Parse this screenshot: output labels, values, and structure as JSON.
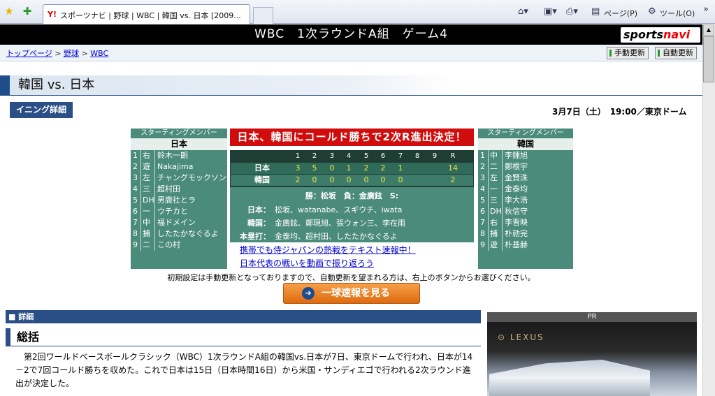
{
  "browser": {
    "tab_title": "スポーツナビ | 野球 | WBC | 韓国 vs. 日本 [2009...",
    "toolbar": {
      "page_menu": "ページ(P)",
      "tools_menu": "ツール(O)"
    },
    "icons": [
      "favorites-star-icon",
      "add-favorites-icon",
      "home-icon",
      "feeds-icon",
      "print-icon",
      "page-icon",
      "tools-gear-icon"
    ]
  },
  "site": {
    "header_title": "WBC　1次ラウンドA組　ゲーム4",
    "logo_sports": "sports",
    "logo_navi": "navi"
  },
  "breadcrumb": [
    {
      "label": "トップページ"
    },
    {
      "label": "野球"
    },
    {
      "label": "WBC"
    }
  ],
  "update_buttons": {
    "manual": "手動更新",
    "auto": "自動更新"
  },
  "page": {
    "title": "韓国 vs. 日本",
    "inning_button": "イニング詳細",
    "date": "3月7日（土）　19:00／東京ドーム"
  },
  "lineup_japan": {
    "caption": "スターティングメンバー",
    "team": "日本",
    "players": [
      {
        "no": "1",
        "pos": "右",
        "name": "鈴木一朗"
      },
      {
        "no": "2",
        "pos": "遊",
        "name": "Nakajima"
      },
      {
        "no": "3",
        "pos": "左",
        "name": "チャングモックソンチン"
      },
      {
        "no": "4",
        "pos": "三",
        "name": "超村田"
      },
      {
        "no": "5",
        "pos": "DH",
        "name": "男鹿社とラ"
      },
      {
        "no": "6",
        "pos": "一",
        "name": "ウチカと"
      },
      {
        "no": "7",
        "pos": "中",
        "name": "福ドメイン"
      },
      {
        "no": "8",
        "pos": "捕",
        "name": "したたかなぐるよ"
      },
      {
        "no": "9",
        "pos": "二",
        "name": "この村"
      }
    ]
  },
  "lineup_korea": {
    "caption": "スターティングメンバー",
    "team": "韓国",
    "players": [
      {
        "no": "1",
        "pos": "中",
        "name": "李鍾旭"
      },
      {
        "no": "2",
        "pos": "二",
        "name": "鄭根宇"
      },
      {
        "no": "3",
        "pos": "左",
        "name": "金賢洙"
      },
      {
        "no": "4",
        "pos": "一",
        "name": "金泰均"
      },
      {
        "no": "5",
        "pos": "三",
        "name": "李大浩"
      },
      {
        "no": "6",
        "pos": "DH",
        "name": "秋信守"
      },
      {
        "no": "7",
        "pos": "右",
        "name": "李晋映"
      },
      {
        "no": "8",
        "pos": "捕",
        "name": "朴勍完"
      },
      {
        "no": "9",
        "pos": "遊",
        "name": "朴基赫"
      }
    ]
  },
  "headline": "日本、韓国にコールド勝ちで2次R進出決定！",
  "scoreboard": {
    "innings": [
      "1",
      "2",
      "3",
      "4",
      "5",
      "6",
      "7",
      "8",
      "9",
      "R"
    ],
    "teams": [
      {
        "name": "日本",
        "scores": [
          "3",
          "5",
          "0",
          "1",
          "2",
          "2",
          "1",
          "",
          "",
          "14"
        ]
      },
      {
        "name": "韓国",
        "scores": [
          "2",
          "0",
          "0",
          "0",
          "0",
          "0",
          "0",
          "",
          "",
          "2"
        ]
      }
    ]
  },
  "results": {
    "decision": "勝：松坂　負：金廣鉉　S:",
    "pitchers_rows": [
      {
        "label": "日本：",
        "value": "松坂、watanabe、スギウチ、iwata"
      },
      {
        "label": "韓国：",
        "value": "金廣鉉、鄭現旭、張ウォン三、李在雨"
      },
      {
        "label": "本塁打：",
        "value": "金泰均、超村田、したたかなぐるよ"
      }
    ]
  },
  "links": {
    "mobile": "携帯でも侍ジャパンの熱戦をテキスト速報中！",
    "video": "日本代表の戦いを動画で振り返ろう"
  },
  "notice": "初期設定は手動更新となっておりますので、自動更新を望まれる方は、右上のボタンからお選びください。",
  "ikkyu_button": "一球速報を見る",
  "detail": {
    "header": "詳細",
    "summary_title": "総括",
    "summary_text": "第2回ワールドベースボールクラシック（WBC）1次ラウンドA組の韓国vs.日本が7日、東京ドームで行われ、日本が14－2で7回コールド勝ちを収めた。これで日本は15日（日本時間16日）から米国・サンディエゴで行われる2次ラウンド進出が決定した。"
  },
  "pr": {
    "label": "PR",
    "brand": "LEXUS"
  }
}
